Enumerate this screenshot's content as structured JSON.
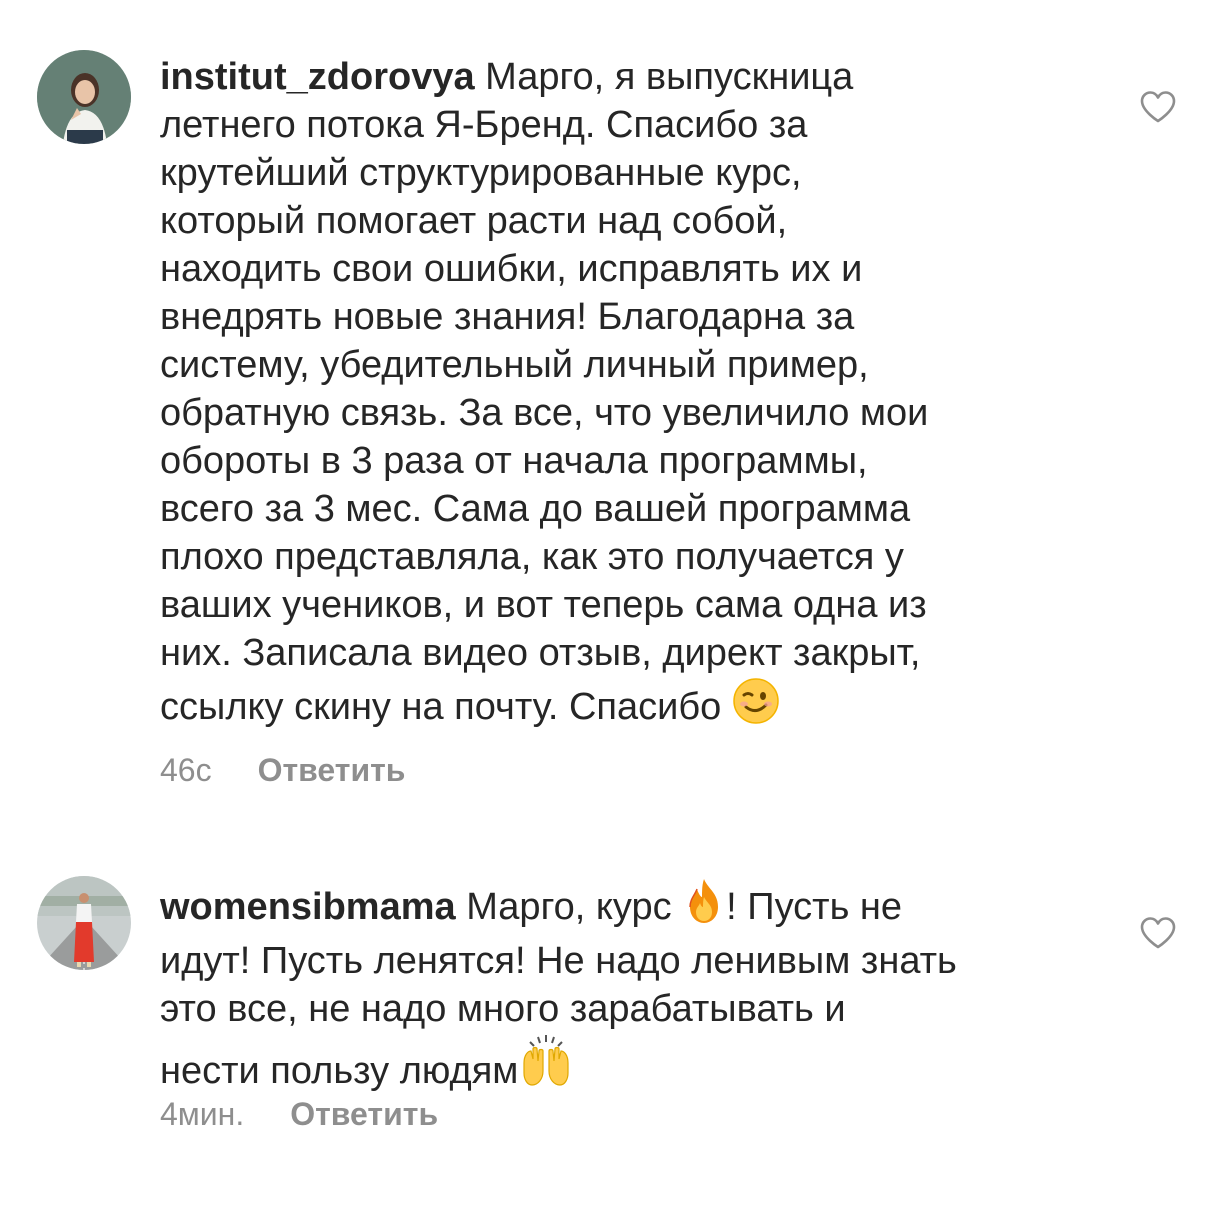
{
  "comments": [
    {
      "username": "institut_zdorovya",
      "text_lines": [
        "Марго, я выпускница",
        "летнего потока Я-Бренд. Спасибо за",
        "крутейший структурированные курс,",
        "который помогает расти над собой,",
        "находить свои ошибки, исправлять их и",
        "внедрять новые знания! Благодарна за",
        "систему, убедительный личный пример,",
        "обратную связь. За все, что увеличило мои",
        "обороты в 3 раза от начала программы,",
        "всего за 3 мес. Сама до вашей программа",
        "плохо представляла, как это получается у",
        "ваших учеников, и вот  теперь сама одна из",
        "них. Записала видео отзыв, директ закрыт,",
        "ссылку скину на почту. Спасибо"
      ],
      "trailing_emoji": "winking-face",
      "time": "46с",
      "reply_label": "Ответить"
    },
    {
      "username": "womensibmama",
      "text_lines": [
        "Марго, курс",
        "! Пусть не",
        "идут! Пусть ленятся! Не надо ленивым знать",
        "это все, не надо много зарабатывать и",
        "нести пользу людям"
      ],
      "inline_emoji": "fire",
      "trailing_emoji": "raising-hands",
      "time": "4мин.",
      "reply_label": "Ответить"
    }
  ],
  "colors": {
    "text": "#262626",
    "meta": "#8e8e8e",
    "heart_outline": "#8e8e8e"
  },
  "icons": [
    "heart-outline-icon",
    "winking-face-emoji",
    "fire-emoji",
    "raising-hands-emoji"
  ]
}
